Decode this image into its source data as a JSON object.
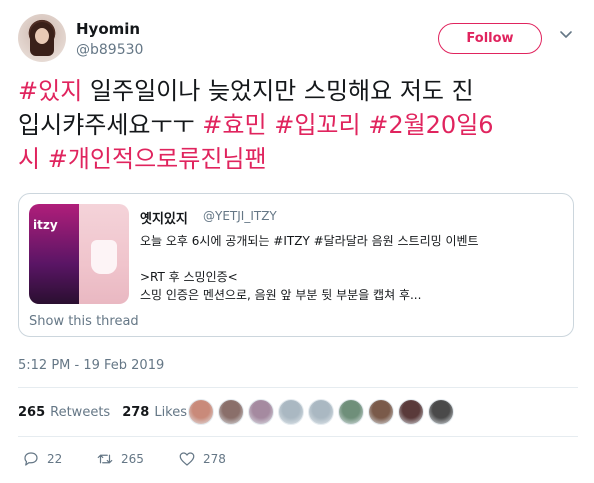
{
  "author": {
    "name": "Hyomin",
    "handle": "@b89530",
    "follow_label": "Follow"
  },
  "tweet_text": {
    "line1_tag": "#있지",
    "line1_text": " 일주일이나 늦었지만 스밍해요 저도 진",
    "line2_text": "입시캬주세요ㅜㅜ ",
    "line2_tag1": "#효민",
    "line2_tag2": "#입꼬리",
    "line2_tag3": "#2월20일6",
    "line3_tag1": "시",
    "line3_tag2": "#개인적으로류진님팬"
  },
  "quote": {
    "name": "옛지있지",
    "handle": "@YETJI_ITZY",
    "line1": "오늘 오후 6시에 공개되는 #ITZY #달라달라 음원 스트리밍 이벤트",
    "line2": "",
    "line3": ">RT 후 스밍인증<",
    "line4": "스밍 인증은 멘션으로, 음원 앞 부분 뒷 부분을 캡쳐 후...",
    "media_logo": "itzy",
    "show_thread": "Show this thread"
  },
  "timestamp": "5:12 PM - 19 Feb 2019",
  "stats": {
    "retweets_count": "265",
    "retweets_label": "Retweets",
    "likes_count": "278",
    "likes_label": "Likes"
  },
  "likers": [
    {
      "color": "#c98a7a"
    },
    {
      "color": "#8a6f6a"
    },
    {
      "color": "#a58aa0"
    },
    {
      "color": "#aab8c2"
    },
    {
      "color": "#aab8c2"
    },
    {
      "color": "#6f8f7a"
    },
    {
      "color": "#7a5a4a"
    },
    {
      "color": "#5a3a3a"
    },
    {
      "color": "#4a4a4a"
    }
  ],
  "actions": {
    "reply_count": "22",
    "retweet_count": "265",
    "like_count": "278"
  },
  "colors": {
    "accent": "#e0245e",
    "muted": "#657786",
    "border": "#ccd6dd"
  }
}
